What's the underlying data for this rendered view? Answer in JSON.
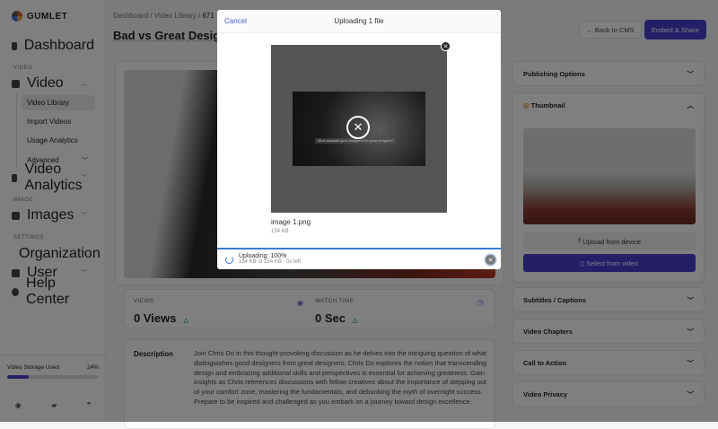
{
  "sidebar": {
    "brand": "GUMLET",
    "dashboard": "Dashboard",
    "sec_video": "VIDEO",
    "video": "Video",
    "video_library": "Video Library",
    "import_videos": "Import Videos",
    "usage_analytics": "Usage Analytics",
    "advanced": "Advanced",
    "video_analytics": "Video Analytics",
    "sec_image": "IMAGE",
    "images": "Images",
    "sec_settings": "SETTINGS",
    "organization": "Organization",
    "user": "User",
    "help_center": "Help Center",
    "storage_label": "Video Storage Used",
    "storage_pct": "24%",
    "storage_value": 24
  },
  "header": {
    "crumb1": "Dashboard",
    "crumb2": "Video Library",
    "crumb3": "671",
    "title": "Bad vs Great Designe",
    "back": "← Back to CMS",
    "embed": "Embed & Share"
  },
  "stats": {
    "views_label": "VIEWS",
    "views": "0 Views",
    "watch_label": "WATCH TIME",
    "watch": "0 Sec"
  },
  "description": {
    "label": "Description",
    "text": "Join Chris Do in this thought-provoking discussion as he delves into the intriguing question of what distinguishes good designers from great designers. Chris Do explores the notion that transcending design and embracing additional skills and perspectives is essential for achieving greatness. Gain insights as Chris references discussions with fellow creatives about the importance of stepping out of your comfort zone, mastering the fundamentals, and debunking the myth of overnight success. Prepare to be inspired and challenged as you embark on a journey toward design excellence."
  },
  "right": {
    "publishing": "Publishing Options",
    "thumbnail": "Thumbnail",
    "upload_device": "Upload from device",
    "select_video": "Select from video",
    "subtitles": "Subtitles / Captions",
    "chapters": "Video Chapters",
    "cta": "Call to Action",
    "privacy": "Video Privacy"
  },
  "modal": {
    "cancel": "Cancel",
    "title": "Uploading 1 file",
    "caption": "What separates good designers from great designers?",
    "file_name": "image 1.png",
    "file_size": "154 KB",
    "status": "Uploading: 100%",
    "progress": "154 KB of 154 KB · 0s left",
    "progress_value": 100
  },
  "colors": {
    "accent": "#4b3fd0",
    "progress": "#3a7bd5"
  }
}
